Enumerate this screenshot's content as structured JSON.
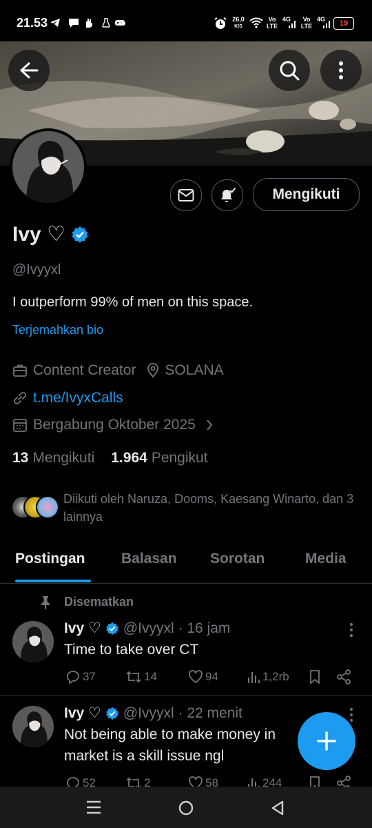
{
  "status_bar": {
    "time": "21.53",
    "speed_value": "26,0",
    "speed_unit": "K/S",
    "sim1_label_top": "Vo",
    "sim1_label_bottom": "LTE",
    "sim1_net": "4G",
    "sim2_label_top": "Vo",
    "sim2_label_bottom": "LTE",
    "sim2_net": "4G",
    "battery": "19"
  },
  "profile": {
    "name": "Ivy ♡",
    "handle": "@Ivyyxl",
    "bio": "I outperform 99% of men on this space.",
    "translate_label": "Terjemahkan bio",
    "category": "Content Creator",
    "location": "SOLANA",
    "link": "t.me/IvyxCalls",
    "joined": "Bergabung Oktober 2025",
    "following_count": "13",
    "following_label": "Mengikuti",
    "followers_count": "1.964",
    "followers_label": "Pengikut",
    "followed_by": "Diikuti oleh Naruza, Dooms, Kaesang Winarto, dan 3 lainnya",
    "follow_button": "Mengikuti"
  },
  "tabs": [
    "Postingan",
    "Balasan",
    "Sorotan",
    "Media"
  ],
  "pinned_label": "Disematkan",
  "posts": [
    {
      "name": "Ivy ♡",
      "meta": "@Ivyyxl · 16 jam",
      "text": "Time to take over CT",
      "replies": "37",
      "reposts": "14",
      "likes": "94",
      "views": "1,2rb"
    },
    {
      "name": "Ivy ♡",
      "meta": "@Ivyyxl · 22 menit",
      "text_line1": "Not being able to make money in",
      "text_line2": "market is a skill issue ngl",
      "replies": "52",
      "reposts": "2",
      "likes": "58",
      "views": "244"
    }
  ],
  "colors": {
    "accent": "#1d9bf0",
    "background": "#000000",
    "secondary_text": "#71767b"
  }
}
